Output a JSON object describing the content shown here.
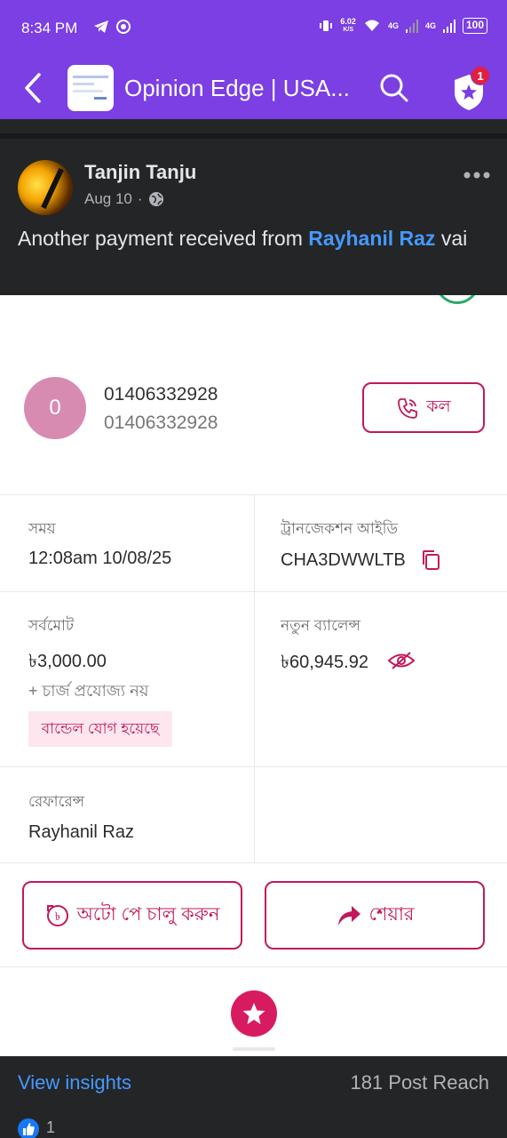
{
  "status_bar": {
    "time": "8:34 PM",
    "speed_value": "6.02",
    "speed_unit": "K/S",
    "net1": "4G",
    "net2": "4G",
    "battery": "100"
  },
  "app_bar": {
    "title": "Opinion Edge | USA...",
    "notification_count": "1"
  },
  "post": {
    "author": "Tanjin Tanju",
    "date": "Aug 10",
    "separator": "·",
    "text_before": "Another payment received from ",
    "mention": "Rayhanil Raz",
    "text_after": " vai"
  },
  "screenshot": {
    "contact_initial": "0",
    "contact_name": "01406332928",
    "contact_number": "01406332928",
    "call_label": "কল",
    "time_label": "সময়",
    "time_value": "12:08am 10/08/25",
    "txn_label": "ট্রানজেকশন আইডি",
    "txn_value": "CHA3DWWLTB",
    "total_label": "সর্বমোট",
    "total_value": "৳3,000.00",
    "charge_note": "+ চার্জ প্রযোজ্য নয়",
    "bundle_tag": "বান্ডেল যোগ হয়েছে",
    "balance_label": "নতুন ব্যালেন্স",
    "balance_value": "৳60,945.92",
    "reference_label": "রেফারেন্স",
    "reference_value": "Rayhanil Raz",
    "autopay_label": "অটো পে চালু করুন",
    "share_label": "শেয়ার"
  },
  "footer": {
    "insights": "View insights",
    "reach": "181 Post Reach",
    "like_count": "1"
  },
  "colors": {
    "brand_purple": "#7b3fe4",
    "accent_pink": "#c2185b",
    "link_blue": "#4599ff"
  }
}
